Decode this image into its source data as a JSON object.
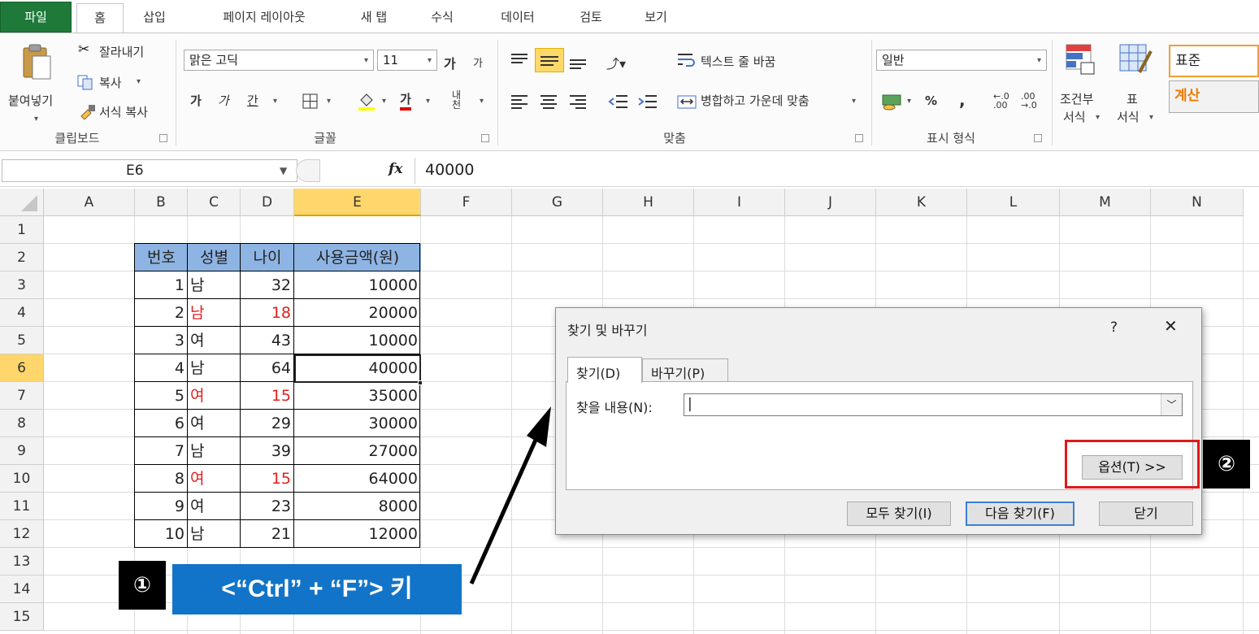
{
  "ribbon": {
    "tabs": [
      "파일",
      "홈",
      "삽입",
      "페이지 레이아웃",
      "새 탭",
      "수식",
      "데이터",
      "검토",
      "보기"
    ],
    "clipboard": {
      "paste": "붙여넣기",
      "cut": "잘라내기",
      "copy": "복사",
      "format_painter": "서식 복사",
      "label": "클립보드"
    },
    "font": {
      "name": "맑은 고딕",
      "size": "11",
      "grow": "가",
      "shrink": "가",
      "bold": "가",
      "italic": "가",
      "underline": "간",
      "font_color": "가",
      "phonetic": "내천",
      "label": "글꼴"
    },
    "alignment": {
      "wrap_text": "텍스트 줄 바꿈",
      "merge_center": "병합하고 가운데 맞춤",
      "label": "맞춤"
    },
    "number": {
      "format": "일반",
      "percent": "%",
      "comma": ",",
      "inc_decimal": "←.0 .00",
      "dec_decimal": ".00 →.0",
      "label": "표시 형식"
    },
    "styles": {
      "conditional_1": "조건부",
      "conditional_2": "서식",
      "table_1": "표",
      "table_2": "서식",
      "normal": "표준",
      "calc": "계산"
    }
  },
  "formula_bar": {
    "name_box": "E6",
    "fx": "fx",
    "value": "40000"
  },
  "columns": [
    "A",
    "B",
    "C",
    "D",
    "E",
    "F",
    "G",
    "H",
    "I",
    "J",
    "K",
    "L",
    "M",
    "N"
  ],
  "rows": [
    "1",
    "2",
    "3",
    "4",
    "5",
    "6",
    "7",
    "8",
    "9",
    "10",
    "11",
    "12",
    "13",
    "14",
    "15"
  ],
  "table": {
    "headers": [
      "번호",
      "성별",
      "나이",
      "사용금액(원)"
    ],
    "rows": [
      {
        "no": "1",
        "gender": "남",
        "age": "32",
        "amount": "10000",
        "red": false
      },
      {
        "no": "2",
        "gender": "남",
        "age": "18",
        "amount": "20000",
        "red": true
      },
      {
        "no": "3",
        "gender": "여",
        "age": "43",
        "amount": "10000",
        "red": false
      },
      {
        "no": "4",
        "gender": "남",
        "age": "64",
        "amount": "40000",
        "red": false
      },
      {
        "no": "5",
        "gender": "여",
        "age": "15",
        "amount": "35000",
        "red": true
      },
      {
        "no": "6",
        "gender": "여",
        "age": "29",
        "amount": "30000",
        "red": false
      },
      {
        "no": "7",
        "gender": "남",
        "age": "39",
        "amount": "27000",
        "red": false
      },
      {
        "no": "8",
        "gender": "여",
        "age": "15",
        "amount": "64000",
        "red": true
      },
      {
        "no": "9",
        "gender": "여",
        "age": "23",
        "amount": "8000",
        "red": false
      },
      {
        "no": "10",
        "gender": "남",
        "age": "21",
        "amount": "12000",
        "red": false
      }
    ]
  },
  "dialog": {
    "title": "찾기 및 바꾸기",
    "help": "?",
    "close": "✕",
    "tab_find": "찾기(D)",
    "tab_replace": "바꾸기(P)",
    "find_label": "찾을 내용(N):",
    "find_value": "|",
    "options": "옵션(T) >>",
    "find_all": "모두 찾기(I)",
    "find_next": "다음 찾기(F)",
    "close_button": "닫기"
  },
  "annotations": {
    "badge1": "①",
    "badge2": "②",
    "callout": "<“Ctrl” + “F”> 키"
  },
  "colors": {
    "file_tab": "#1f7a3a",
    "header_fill": "#8eb4e3",
    "callout": "#1274c8",
    "highlight": "#e01818",
    "red_text": "#e02020"
  }
}
